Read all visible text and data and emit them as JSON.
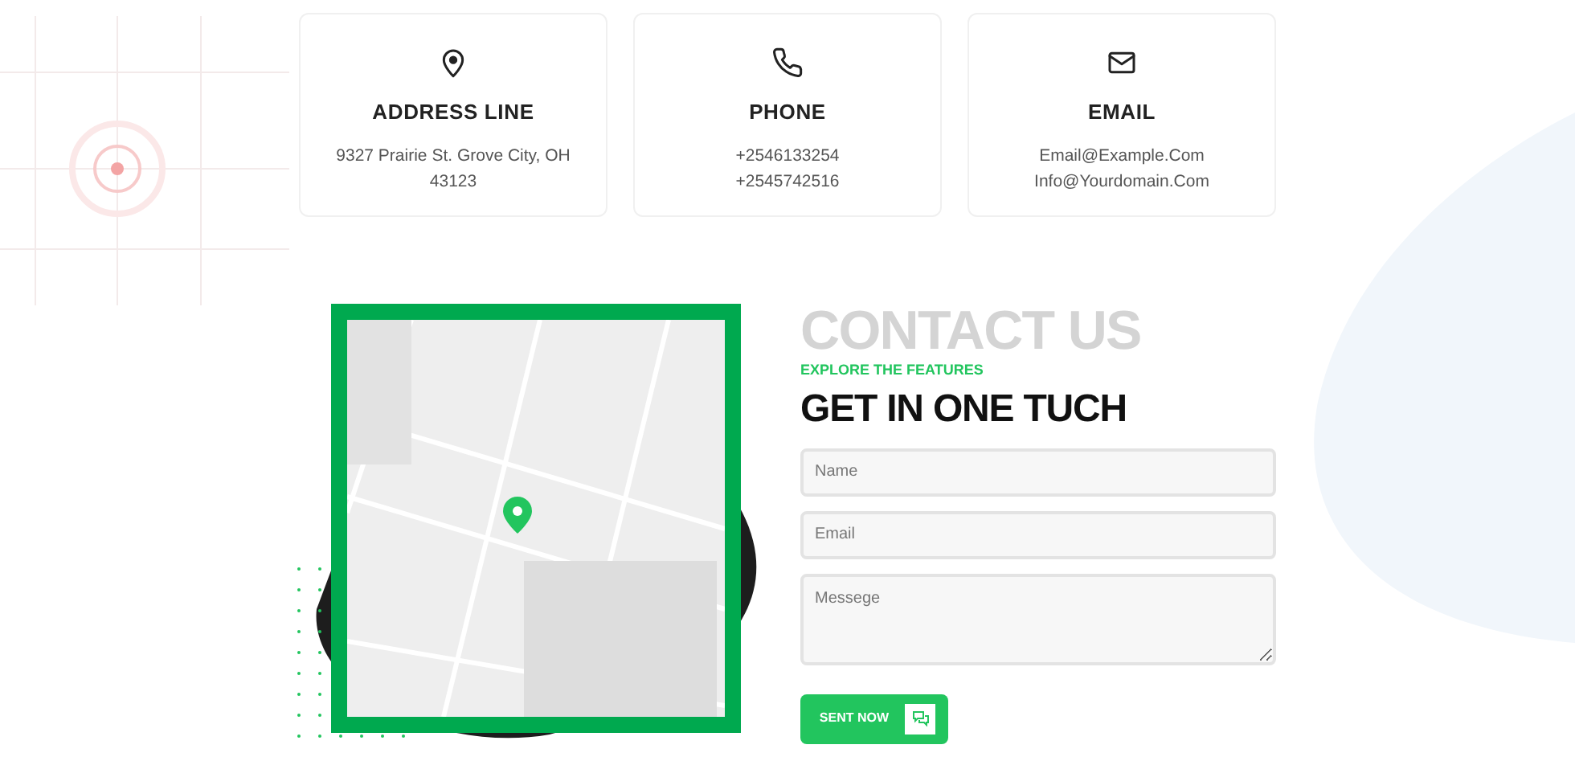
{
  "contact_cards": [
    {
      "kind": "address",
      "title": "ADDRESS LINE",
      "lines": [
        "9327 Prairie St. Grove City, OH 43123"
      ]
    },
    {
      "kind": "phone",
      "title": "PHONE",
      "lines": [
        "+2546133254",
        "+2545742516"
      ]
    },
    {
      "kind": "email",
      "title": "EMAIL",
      "lines": [
        "Email@Example.Com",
        "Info@Yourdomain.Com"
      ]
    }
  ],
  "contact_section": {
    "background_title": "CONTACT US",
    "eyebrow": "EXPLORE THE FEATURES",
    "heading": "GET IN ONE TUCH",
    "fields": [
      {
        "kind": "input",
        "placeholder": "Name"
      },
      {
        "kind": "input",
        "placeholder": "Email"
      },
      {
        "kind": "textarea",
        "placeholder": "Messege"
      }
    ],
    "submit_button": "SENT NOW"
  }
}
